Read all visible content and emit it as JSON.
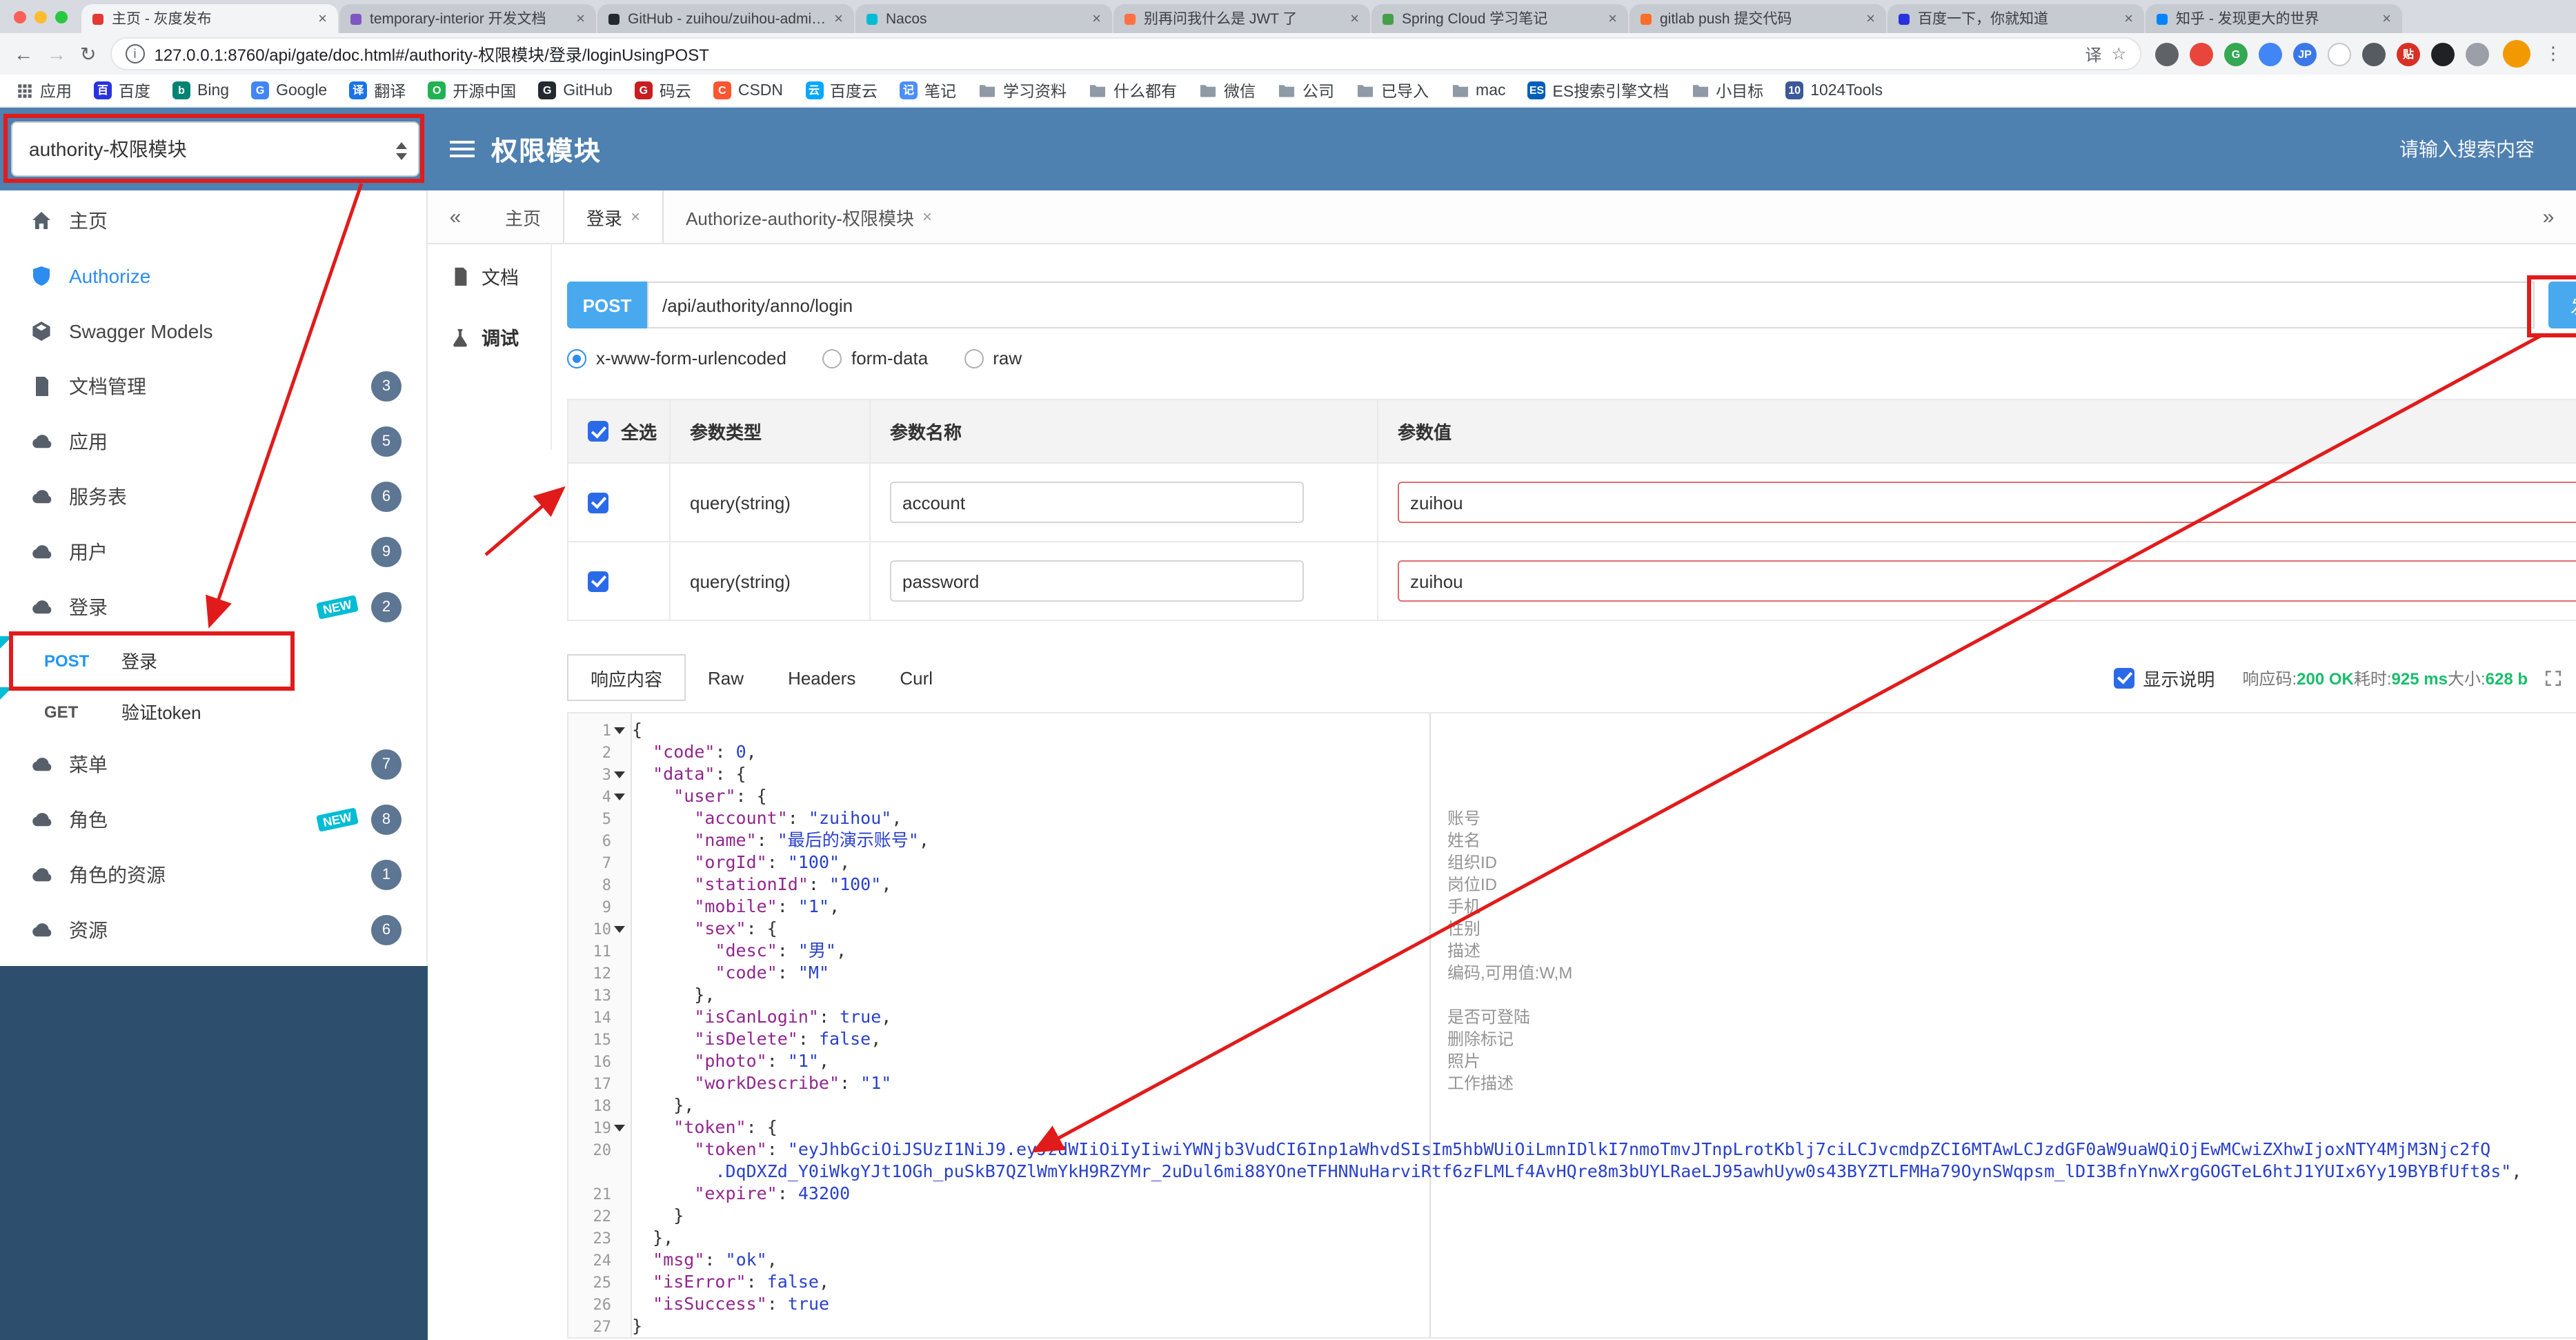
{
  "browser": {
    "tabs": [
      {
        "title": "主页 - 灰度发布",
        "color": "#e53935"
      },
      {
        "title": "temporary-interior 开发文档",
        "color": "#7e57c2"
      },
      {
        "title": "GitHub - zuihou/zuihou-admin-cloud",
        "color": "#24292e"
      },
      {
        "title": "Nacos",
        "color": "#00bcd4"
      },
      {
        "title": "别再问我什么是 JWT 了",
        "color": "#ff7043"
      },
      {
        "title": "Spring Cloud 学习笔记",
        "color": "#43a047"
      },
      {
        "title": "gitlab push 提交代码",
        "color": "#fc6d26"
      },
      {
        "title": "百度一下，你就知道",
        "color": "#2932e1"
      },
      {
        "title": "知乎 - 发现更大的世界",
        "color": "#0084ff"
      }
    ],
    "back_icon": "←",
    "forward_icon": "→",
    "reload_icon": "↻",
    "info_icon": "i",
    "url": "127.0.0.1:8760/api/gate/doc.html#/authority-权限模块/登录/loginUsingPOST",
    "translate_icon": "译",
    "star_icon": "☆",
    "menu_icon": "⋮",
    "extensions": [
      {
        "name": "screenshot-ext-icon",
        "color": "#5f6368",
        "label": ""
      },
      {
        "name": "red-ext-icon",
        "color": "#e8453c",
        "label": ""
      },
      {
        "name": "green-ext-icon",
        "color": "#34a853",
        "label": "G"
      },
      {
        "name": "blue-ext-icon",
        "color": "#4285f4",
        "label": ""
      },
      {
        "name": "jp-ext-icon",
        "color": "#3b78e7",
        "label": "JP"
      },
      {
        "name": "white-ext-icon",
        "color": "#ffffff",
        "label": ""
      },
      {
        "name": "shield-ext-icon",
        "color": "#555b61",
        "label": ""
      },
      {
        "name": "clip-ext-icon",
        "color": "#d93025",
        "label": "贴"
      },
      {
        "name": "dark-ext-icon",
        "color": "#202124",
        "label": ""
      },
      {
        "name": "puzzle-ext-icon",
        "color": "#9aa0a6",
        "label": ""
      }
    ],
    "bookmarks": [
      {
        "label": "应用",
        "icon": "grid"
      },
      {
        "label": "百度",
        "icon": "letter",
        "letter": "百",
        "color": "#2932e1"
      },
      {
        "label": "Bing",
        "icon": "letter",
        "letter": "b",
        "color": "#008373"
      },
      {
        "label": "Google",
        "icon": "letter",
        "letter": "G",
        "color": "#4285f4"
      },
      {
        "label": "翻译",
        "icon": "letter",
        "letter": "译",
        "color": "#1a73e8"
      },
      {
        "label": "开源中国",
        "icon": "letter",
        "letter": "O",
        "color": "#21b351"
      },
      {
        "label": "GitHub",
        "icon": "letter",
        "letter": "G",
        "color": "#24292e"
      },
      {
        "label": "码云",
        "icon": "letter",
        "letter": "G",
        "color": "#c71d23"
      },
      {
        "label": "CSDN",
        "icon": "letter",
        "letter": "C",
        "color": "#fc5531"
      },
      {
        "label": "百度云",
        "icon": "letter",
        "letter": "云",
        "color": "#06a7ff"
      },
      {
        "label": "笔记",
        "icon": "letter",
        "letter": "记",
        "color": "#4c8ffb"
      },
      {
        "label": "学习资料",
        "icon": "folder"
      },
      {
        "label": "什么都有",
        "icon": "folder"
      },
      {
        "label": "微信",
        "icon": "folder"
      },
      {
        "label": "公司",
        "icon": "folder"
      },
      {
        "label": "已导入",
        "icon": "folder"
      },
      {
        "label": "mac",
        "icon": "folder"
      },
      {
        "label": "ES搜索引擎文档",
        "icon": "letter",
        "letter": "ES",
        "color": "#005eb8"
      },
      {
        "label": "小目标",
        "icon": "folder"
      },
      {
        "label": "1024Tools",
        "icon": "letter",
        "letter": "10",
        "color": "#3b5998"
      }
    ]
  },
  "header": {
    "module_select": "authority-权限模块",
    "title": "权限模块",
    "search_placeholder": "请输入搜索内容"
  },
  "sidebar": {
    "new_label": "NEW",
    "items": [
      {
        "type": "item",
        "key": "home",
        "icon": "home",
        "label": "主页"
      },
      {
        "type": "item",
        "key": "authorize",
        "icon": "shield",
        "label": "Authorize",
        "accent": true
      },
      {
        "type": "item",
        "key": "swagger-models",
        "icon": "models",
        "label": "Swagger Models"
      },
      {
        "type": "item",
        "key": "doc-manage",
        "icon": "docs",
        "label": "文档管理",
        "count": "3"
      },
      {
        "type": "item",
        "key": "application",
        "icon": "cloud",
        "label": "应用",
        "count": "5"
      },
      {
        "type": "item",
        "key": "service-table",
        "icon": "cloud",
        "label": "服务表",
        "count": "6"
      },
      {
        "type": "item",
        "key": "user",
        "icon": "cloud",
        "label": "用户",
        "count": "9"
      },
      {
        "type": "item",
        "key": "login",
        "icon": "cloud",
        "label": "登录",
        "count": "2",
        "isNew": true
      },
      {
        "type": "sub",
        "key": "login-post",
        "method": "POST",
        "label": "登录",
        "flag": true
      },
      {
        "type": "sub",
        "key": "verify-token-get",
        "method": "GET",
        "label": "验证token",
        "flag": true
      },
      {
        "type": "item",
        "key": "menu",
        "icon": "cloud",
        "label": "菜单",
        "count": "7"
      },
      {
        "type": "item",
        "key": "role",
        "icon": "cloud",
        "label": "角色",
        "count": "8",
        "isNew": true
      },
      {
        "type": "item",
        "key": "role-resource",
        "icon": "cloud",
        "label": "角色的资源",
        "count": "1"
      },
      {
        "type": "item",
        "key": "resource",
        "icon": "cloud",
        "label": "资源",
        "count": "6"
      }
    ]
  },
  "main_tabs": {
    "left_arrow": "«",
    "right_arrow": "»",
    "items": [
      {
        "label": "主页",
        "closable": false,
        "active": false
      },
      {
        "label": "登录",
        "closable": true,
        "active": true
      },
      {
        "label": "Authorize-authority-权限模块",
        "closable": true,
        "active": false
      }
    ]
  },
  "doc_tools": {
    "items": [
      {
        "label": "文档",
        "icon": "docs",
        "active": false
      },
      {
        "label": "调试",
        "icon": "flask",
        "active": true
      }
    ]
  },
  "request": {
    "method": "POST",
    "path": "/api/authority/anno/login",
    "send_label": "发送",
    "body_types": [
      {
        "label": "x-www-form-urlencoded",
        "selected": true
      },
      {
        "label": "form-data",
        "selected": false
      },
      {
        "label": "raw",
        "selected": false
      }
    ]
  },
  "params_table": {
    "select_all_label": "全选",
    "type_label": "参数类型",
    "name_label": "参数名称",
    "value_label": "参数值",
    "rows": [
      {
        "checked": true,
        "type": "query(string)",
        "name": "account",
        "value": "zuihou"
      },
      {
        "checked": true,
        "type": "query(string)",
        "name": "password",
        "value": "zuihou"
      }
    ]
  },
  "response": {
    "tabs": [
      "响应内容",
      "Raw",
      "Headers",
      "Curl"
    ],
    "active_tab": "响应内容",
    "show_desc_label": "显示说明",
    "meta": {
      "code_label": "响应码:",
      "code": "200 OK",
      "time_label": "耗时:",
      "time": "925 ms",
      "size_label": "大小:",
      "size": "628 b"
    }
  },
  "code": {
    "rows": [
      {
        "no": "1",
        "fold": true,
        "segs": [
          [
            "p",
            "{"
          ]
        ]
      },
      {
        "no": "2",
        "segs": [
          [
            "p",
            "  "
          ],
          [
            "k",
            "\"code\""
          ],
          [
            "p",
            ": "
          ],
          [
            "n",
            "0"
          ],
          [
            "p",
            ","
          ]
        ]
      },
      {
        "no": "3",
        "fold": true,
        "segs": [
          [
            "p",
            "  "
          ],
          [
            "k",
            "\"data\""
          ],
          [
            "p",
            ": {"
          ]
        ]
      },
      {
        "no": "4",
        "fold": true,
        "segs": [
          [
            "p",
            "    "
          ],
          [
            "k",
            "\"user\""
          ],
          [
            "p",
            ": {"
          ]
        ]
      },
      {
        "no": "5",
        "segs": [
          [
            "p",
            "      "
          ],
          [
            "k",
            "\"account\""
          ],
          [
            "p",
            ": "
          ],
          [
            "s",
            "\"zuihou\""
          ],
          [
            "p",
            ","
          ]
        ]
      },
      {
        "no": "6",
        "segs": [
          [
            "p",
            "      "
          ],
          [
            "k",
            "\"name\""
          ],
          [
            "p",
            ": "
          ],
          [
            "s",
            "\"最后的演示账号\""
          ],
          [
            "p",
            ","
          ]
        ]
      },
      {
        "no": "7",
        "segs": [
          [
            "p",
            "      "
          ],
          [
            "k",
            "\"orgId\""
          ],
          [
            "p",
            ": "
          ],
          [
            "s",
            "\"100\""
          ],
          [
            "p",
            ","
          ]
        ]
      },
      {
        "no": "8",
        "segs": [
          [
            "p",
            "      "
          ],
          [
            "k",
            "\"stationId\""
          ],
          [
            "p",
            ": "
          ],
          [
            "s",
            "\"100\""
          ],
          [
            "p",
            ","
          ]
        ]
      },
      {
        "no": "9",
        "segs": [
          [
            "p",
            "      "
          ],
          [
            "k",
            "\"mobile\""
          ],
          [
            "p",
            ": "
          ],
          [
            "s",
            "\"1\""
          ],
          [
            "p",
            ","
          ]
        ]
      },
      {
        "no": "10",
        "fold": true,
        "segs": [
          [
            "p",
            "      "
          ],
          [
            "k",
            "\"sex\""
          ],
          [
            "p",
            ": {"
          ]
        ]
      },
      {
        "no": "11",
        "segs": [
          [
            "p",
            "        "
          ],
          [
            "k",
            "\"desc\""
          ],
          [
            "p",
            ": "
          ],
          [
            "s",
            "\"男\""
          ],
          [
            "p",
            ","
          ]
        ]
      },
      {
        "no": "12",
        "segs": [
          [
            "p",
            "        "
          ],
          [
            "k",
            "\"code\""
          ],
          [
            "p",
            ": "
          ],
          [
            "s",
            "\"M\""
          ]
        ]
      },
      {
        "no": "13",
        "segs": [
          [
            "p",
            "      },"
          ]
        ]
      },
      {
        "no": "14",
        "segs": [
          [
            "p",
            "      "
          ],
          [
            "k",
            "\"isCanLogin\""
          ],
          [
            "p",
            ": "
          ],
          [
            "b",
            "true"
          ],
          [
            "p",
            ","
          ]
        ]
      },
      {
        "no": "15",
        "segs": [
          [
            "p",
            "      "
          ],
          [
            "k",
            "\"isDelete\""
          ],
          [
            "p",
            ": "
          ],
          [
            "b",
            "false"
          ],
          [
            "p",
            ","
          ]
        ]
      },
      {
        "no": "16",
        "segs": [
          [
            "p",
            "      "
          ],
          [
            "k",
            "\"photo\""
          ],
          [
            "p",
            ": "
          ],
          [
            "s",
            "\"1\""
          ],
          [
            "p",
            ","
          ]
        ]
      },
      {
        "no": "17",
        "segs": [
          [
            "p",
            "      "
          ],
          [
            "k",
            "\"workDescribe\""
          ],
          [
            "p",
            ": "
          ],
          [
            "s",
            "\"1\""
          ]
        ]
      },
      {
        "no": "18",
        "segs": [
          [
            "p",
            "    },"
          ]
        ]
      },
      {
        "no": "19",
        "fold": true,
        "segs": [
          [
            "p",
            "    "
          ],
          [
            "k",
            "\"token\""
          ],
          [
            "p",
            ": {"
          ]
        ]
      },
      {
        "no": "20",
        "segs": [
          [
            "p",
            "      "
          ],
          [
            "k",
            "\"token\""
          ],
          [
            "p",
            ": "
          ],
          [
            "s",
            "\"eyJhbGciOiJSUzI1NiJ9.eyJzdWIiOiIyIiwiYWNjb3VudCI6Inp1aWhvdSIsIm5hbWUiOiLmnIDlkI7nmoTmvJTnpLrotKblj7ciLCJvcmdpZCI6MTAwLCJzdGF0aW9uaWQiOjEwMCwiZXhwIjoxNTY4MjM3Njc2fQ"
          ]
        ]
      },
      {
        "no": "",
        "segs": [
          [
            "p",
            "        "
          ],
          [
            "s",
            ".DqDXZd_Y0iWkgYJt1OGh_puSkB7QZlWmYkH9RZYMr_2uDul6mi88YOneTFHNNuHarviRtf6zFLMLf4AvHQre8m3bUYLRaeLJ95awhUyw0s43BYZTLFMHa79OynSWqpsm_lDI3BfnYnwXrgGOGTeL6htJ1YUIx6Yy19BYBfUft8s\""
          ],
          [
            "p",
            ","
          ]
        ]
      },
      {
        "no": "21",
        "segs": [
          [
            "p",
            "      "
          ],
          [
            "k",
            "\"expire\""
          ],
          [
            "p",
            ": "
          ],
          [
            "n",
            "43200"
          ]
        ]
      },
      {
        "no": "22",
        "segs": [
          [
            "p",
            "    }"
          ]
        ]
      },
      {
        "no": "23",
        "segs": [
          [
            "p",
            "  },"
          ]
        ]
      },
      {
        "no": "24",
        "segs": [
          [
            "p",
            "  "
          ],
          [
            "k",
            "\"msg\""
          ],
          [
            "p",
            ": "
          ],
          [
            "s",
            "\"ok\""
          ],
          [
            "p",
            ","
          ]
        ]
      },
      {
        "no": "25",
        "segs": [
          [
            "p",
            "  "
          ],
          [
            "k",
            "\"isError\""
          ],
          [
            "p",
            ": "
          ],
          [
            "b",
            "false"
          ],
          [
            "p",
            ","
          ]
        ]
      },
      {
        "no": "26",
        "segs": [
          [
            "p",
            "  "
          ],
          [
            "k",
            "\"isSuccess\""
          ],
          [
            "p",
            ": "
          ],
          [
            "b",
            "true"
          ]
        ]
      },
      {
        "no": "27",
        "segs": [
          [
            "p",
            "}"
          ]
        ]
      }
    ]
  },
  "descriptions": [
    {
      "row": 5,
      "text": "账号"
    },
    {
      "row": 6,
      "text": "姓名"
    },
    {
      "row": 7,
      "text": "组织ID"
    },
    {
      "row": 8,
      "text": "岗位ID"
    },
    {
      "row": 9,
      "text": "手机"
    },
    {
      "row": 10,
      "text": "性别"
    },
    {
      "row": 11,
      "text": "描述"
    },
    {
      "row": 12,
      "text": "编码,可用值:W,M"
    },
    {
      "row": 14,
      "text": "是否可登陆"
    },
    {
      "row": 15,
      "text": "删除标记"
    },
    {
      "row": 16,
      "text": "照片"
    },
    {
      "row": 17,
      "text": "工作描述"
    }
  ]
}
